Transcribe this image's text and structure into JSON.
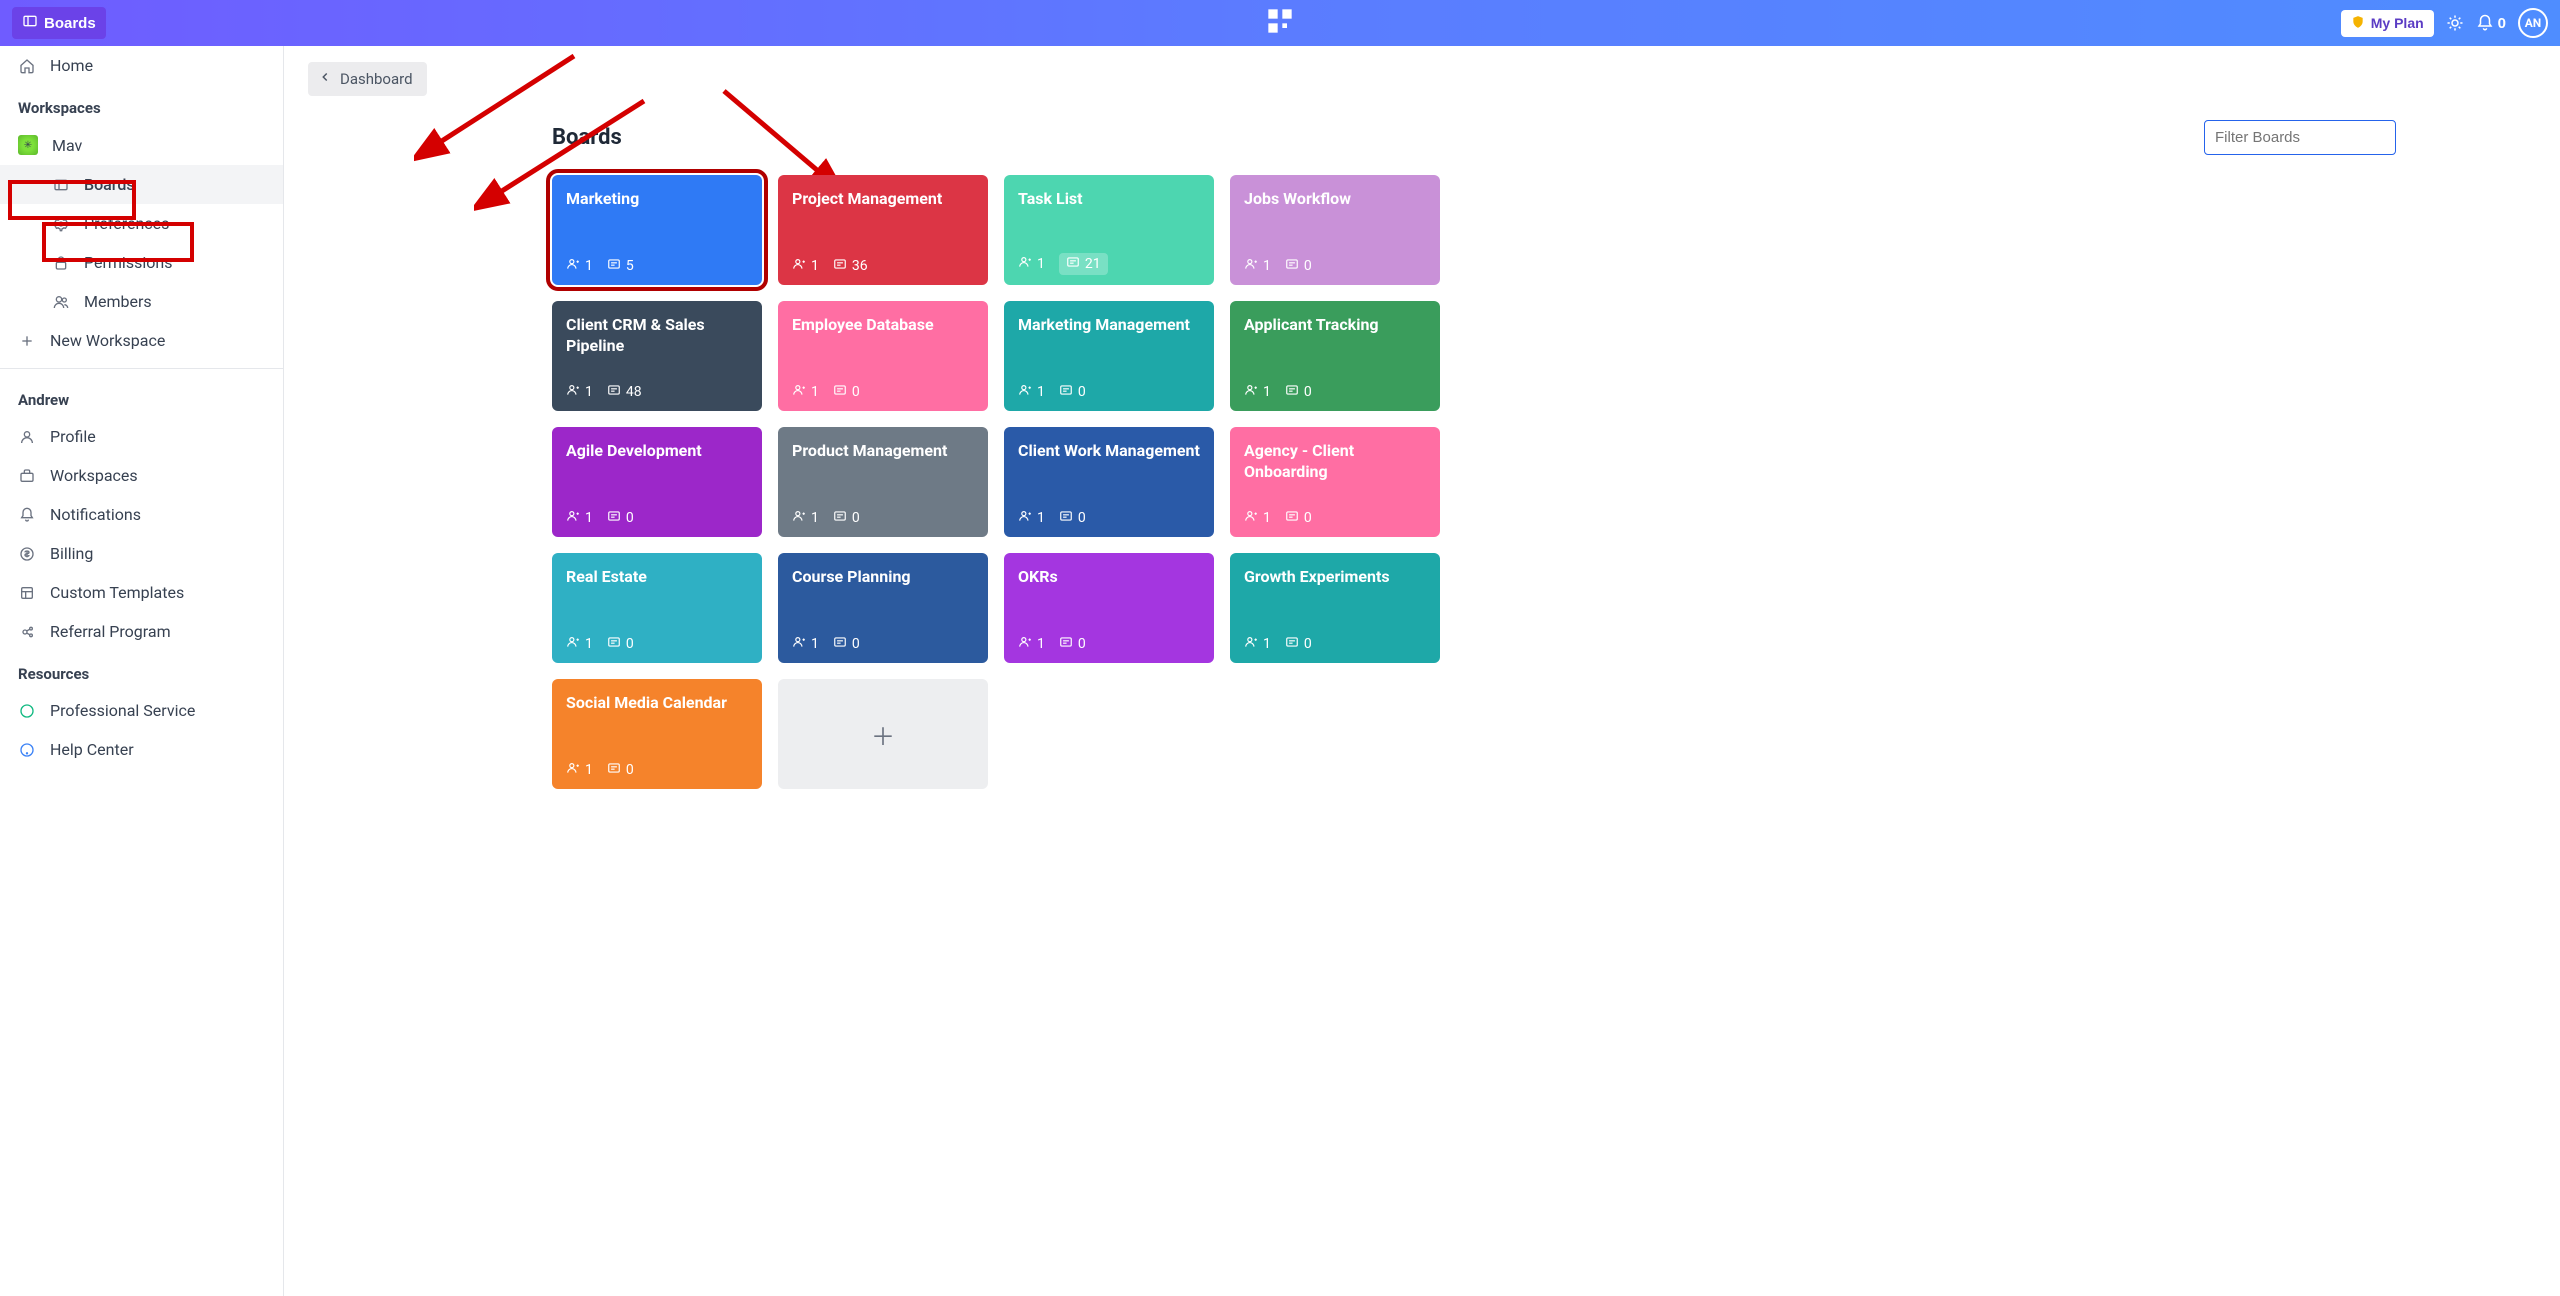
{
  "topbar": {
    "boards_label": "Boards",
    "plan_label": "My Plan",
    "notif_count": "0",
    "avatar_initials": "AN"
  },
  "sidebar": {
    "home": "Home",
    "workspaces_heading": "Workspaces",
    "current_ws": "Mav",
    "ws_items": {
      "boards": "Boards",
      "preferences": "Preferences",
      "permissions": "Permissions",
      "members": "Members"
    },
    "new_workspace": "New Workspace",
    "user_heading": "Andrew",
    "user_items": {
      "profile": "Profile",
      "workspaces": "Workspaces",
      "notifications": "Notifications",
      "billing": "Billing",
      "custom_templates": "Custom Templates",
      "referral": "Referral Program"
    },
    "resources_heading": "Resources",
    "resources_items": {
      "pro_service": "Professional Service",
      "help_center": "Help Center"
    }
  },
  "main": {
    "breadcrumb": "Dashboard",
    "title": "Boards",
    "filter_placeholder": "Filter Boards"
  },
  "boards": [
    {
      "title": "Marketing",
      "members": "1",
      "cards": "5",
      "color": "#2f7af5",
      "hl": true
    },
    {
      "title": "Project Management",
      "members": "1",
      "cards": "36",
      "color": "#dc3545"
    },
    {
      "title": "Task List",
      "members": "1",
      "cards": "21",
      "color": "#4dd6b0",
      "light": true
    },
    {
      "title": "Jobs Workflow",
      "members": "1",
      "cards": "0",
      "color": "#c991d8"
    },
    {
      "title": "Client CRM & Sales Pipeline",
      "members": "1",
      "cards": "48",
      "color": "#3a4a5c"
    },
    {
      "title": "Employee Database",
      "members": "1",
      "cards": "0",
      "color": "#ff6ea3"
    },
    {
      "title": "Marketing Management",
      "members": "1",
      "cards": "0",
      "color": "#1ea8a8"
    },
    {
      "title": "Applicant Tracking",
      "members": "1",
      "cards": "0",
      "color": "#3a9d5c"
    },
    {
      "title": "Agile Development",
      "members": "1",
      "cards": "0",
      "color": "#9c27c9"
    },
    {
      "title": "Product Management",
      "members": "1",
      "cards": "0",
      "color": "#6e7a86"
    },
    {
      "title": "Client Work Management",
      "members": "1",
      "cards": "0",
      "color": "#2a5aa8"
    },
    {
      "title": "Agency - Client Onboarding",
      "members": "1",
      "cards": "0",
      "color": "#ff6ea3"
    },
    {
      "title": "Real Estate",
      "members": "1",
      "cards": "0",
      "color": "#2fb0c4"
    },
    {
      "title": "Course Planning",
      "members": "1",
      "cards": "0",
      "color": "#2c5a9e"
    },
    {
      "title": "OKRs",
      "members": "1",
      "cards": "0",
      "color": "#a436e0"
    },
    {
      "title": "Growth Experiments",
      "members": "1",
      "cards": "0",
      "color": "#1ea8a8"
    },
    {
      "title": "Social Media Calendar",
      "members": "1",
      "cards": "0",
      "color": "#f5832b"
    }
  ]
}
